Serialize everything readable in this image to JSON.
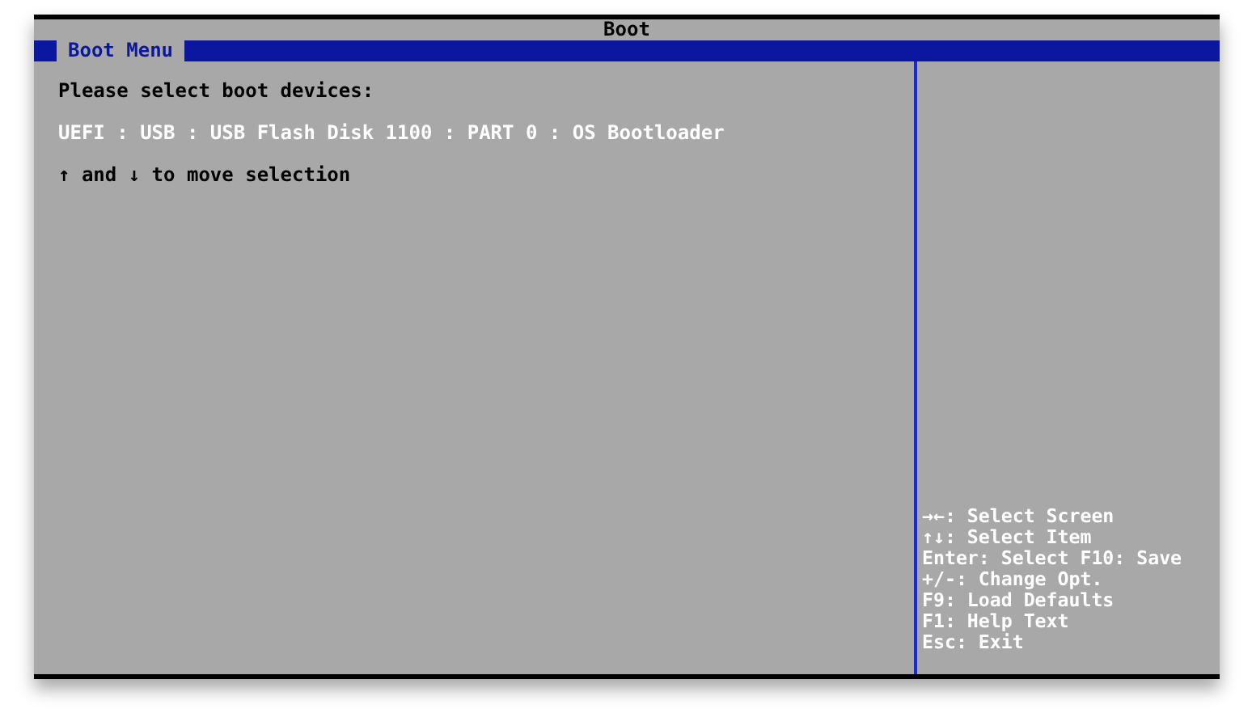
{
  "window": {
    "title": "Boot"
  },
  "tabs": [
    {
      "label": "Boot Menu",
      "selected": true
    }
  ],
  "content": [
    {
      "kind": "heading",
      "text": "Please select boot devices:"
    },
    {
      "kind": "option",
      "text": "UEFI : USB : USB Flash Disk 1100 : PART 0 : OS Bootloader"
    },
    {
      "kind": "hint",
      "text": "↑ and ↓ to move selection"
    }
  ],
  "help": [
    "→←: Select Screen",
    "↑↓: Select Item",
    "Enter: Select F10: Save",
    "+/-: Change Opt.",
    "F9: Load Defaults",
    "F1: Help Text",
    "Esc: Exit"
  ]
}
